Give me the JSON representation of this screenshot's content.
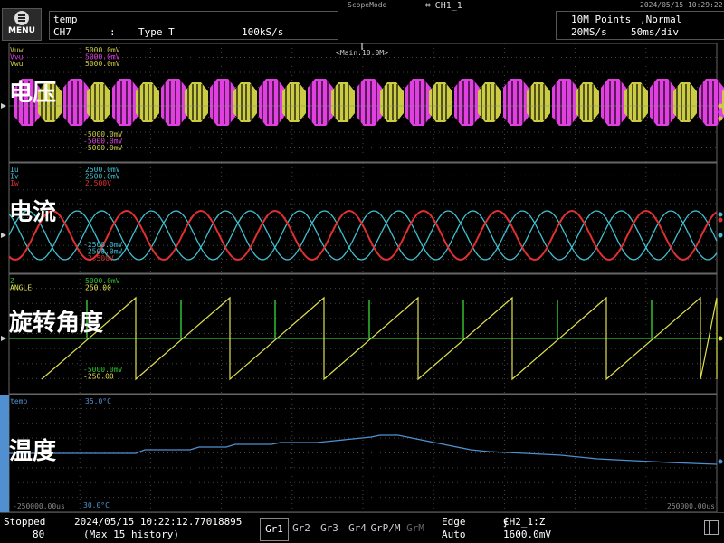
{
  "top": {
    "menu_label": "MENU",
    "mode_label": "ScopeMode",
    "ch_label": "CH1_1",
    "datetime": "2024/05/15 10:29:22",
    "trace_name": "temp",
    "channel": "CH7",
    "colon": ":",
    "type": "Type T",
    "rate": "100kS/s",
    "points": "10M Points",
    "trig_mode": ",Normal",
    "sample_rate": "20MS/s",
    "timebase": "50ms/div",
    "main_marker": "<Main:10.0M>",
    "marker_T": "T"
  },
  "groups": [
    {
      "label": "电压",
      "channels": [
        {
          "name": "Vuw",
          "color": "#cccc44",
          "scale": "5000.0mV"
        },
        {
          "name": "Vvu",
          "color": "#e040e0",
          "scale": "5000.0mV"
        },
        {
          "name": "Vwu",
          "color": "#cccc44",
          "scale": "5000.0mV"
        }
      ],
      "bottom": [
        "-5000.0mV",
        "-5000.0mV",
        "-5000.0mV"
      ]
    },
    {
      "label": "电流",
      "channels": [
        {
          "name": "Iu",
          "color": "#40c0d0",
          "scale": "2500.0mV"
        },
        {
          "name": "Iv",
          "color": "#40c0d0",
          "scale": "2500.0mV"
        },
        {
          "name": "Iw",
          "color": "#e03030",
          "scale": "2.500V"
        }
      ],
      "bottom": [
        "-2500.0mV",
        "-2500.0mV",
        "-2.500V"
      ]
    },
    {
      "label": "旋转角度",
      "channels": [
        {
          "name": "Z",
          "color": "#30c030",
          "scale": "5000.0mV"
        },
        {
          "name": "ANGLE",
          "color": "#e0e050",
          "scale": "250.00"
        }
      ],
      "bottom": [
        "-5000.0mV",
        "-250.00"
      ]
    },
    {
      "label": "温度",
      "channels": [
        {
          "name": "temp",
          "color": "#5090d0",
          "scale": "35.0°C"
        }
      ],
      "bottom": [
        "30.0°C"
      ],
      "time_left": "-250000.00us",
      "time_right": "250000.00us"
    }
  ],
  "bottom": {
    "status": "Stopped",
    "count": "80",
    "timestamp": "2024/05/15 10:22:12.77018895",
    "history": "(Max 15 history)",
    "groups": [
      "Gr1",
      "Gr2",
      "Gr3",
      "Gr4",
      "GrP/M",
      "GrM"
    ],
    "trigger_type": "Edge",
    "trigger_mode": "Auto",
    "trigger_source": "CH2_1:Z",
    "trigger_level": "1600.0mV"
  }
}
